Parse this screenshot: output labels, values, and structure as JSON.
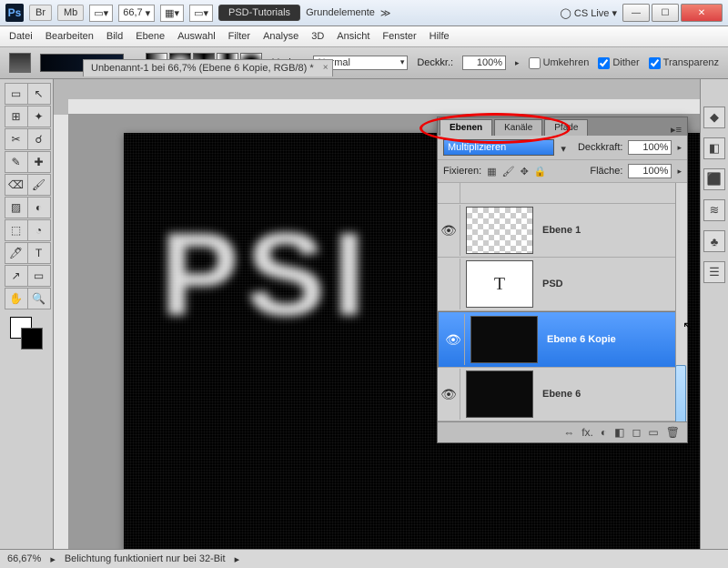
{
  "titlebar": {
    "zoom": "66,7",
    "workspace_btn": "PSD-Tutorials",
    "workspace2": "Grundelemente",
    "cslive": "CS Live"
  },
  "menu": [
    "Datei",
    "Bearbeiten",
    "Bild",
    "Ebene",
    "Auswahl",
    "Filter",
    "Analyse",
    "3D",
    "Ansicht",
    "Fenster",
    "Hilfe"
  ],
  "options": {
    "mode_label": "Modus:",
    "mode_value": "Normal",
    "opacity_label": "Deckkr.:",
    "opacity_value": "100%",
    "reverse": "Umkehren",
    "dither": "Dither",
    "transparency": "Transparenz"
  },
  "doc": {
    "tab": "Unbenannt-1 bei 66,7% (Ebene 6 Kopie, RGB/8) *",
    "cloud_text": "PSI"
  },
  "layers_panel": {
    "tabs": [
      "Ebenen",
      "Kanäle",
      "Pfade"
    ],
    "blend_mode": "Multiplizieren",
    "opacity_label": "Deckkraft:",
    "opacity_value": "100%",
    "lock_label": "Fixieren:",
    "fill_label": "Fläche:",
    "fill_value": "100%",
    "layers": [
      {
        "name": "Ebene 1",
        "thumb": "checker",
        "eye": true
      },
      {
        "name": "PSD",
        "thumb": "T",
        "eye": false
      },
      {
        "name": "Ebene 6 Kopie",
        "thumb": "dark",
        "eye": true,
        "selected": true
      },
      {
        "name": "Ebene 6",
        "thumb": "dark",
        "eye": true
      }
    ],
    "bottom_icons": [
      "⇔",
      "fx.",
      "◐",
      "◧",
      "◻",
      "▭",
      "🗑"
    ]
  },
  "status": {
    "zoom": "66,67%",
    "msg": "Belichtung funktioniert nur bei 32-Bit"
  },
  "tool_icons": [
    "▭",
    "↖",
    "⊞",
    "✦",
    "✂",
    "☌",
    "✎",
    "✚",
    "⌫",
    "🖌",
    "▨",
    "◐",
    "⬚",
    "◔",
    "🖊",
    "T",
    "↗",
    "▭",
    "✋",
    "🔍"
  ],
  "dock_icons": [
    "◆",
    "◧",
    "⬛",
    "≋",
    "♣",
    "☰"
  ]
}
